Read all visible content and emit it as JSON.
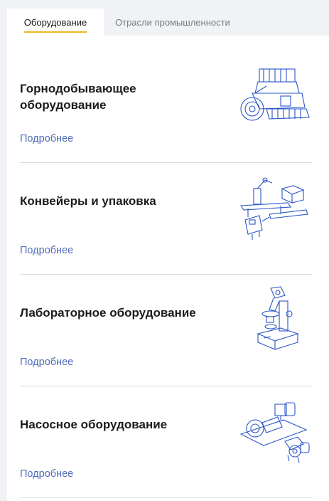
{
  "tabs": [
    {
      "label": "Оборудование",
      "active": true
    },
    {
      "label": "Отрасли промышленности",
      "active": false
    }
  ],
  "cards": [
    {
      "title": "Горнодобывающее оборудование",
      "link": "Подробнее",
      "illustration": "mining-machine-icon"
    },
    {
      "title": "Конвейеры и упаковка",
      "link": "Подробнее",
      "illustration": "conveyor-robot-arm-icon"
    },
    {
      "title": "Лабораторное оборудование",
      "link": "Подробнее",
      "illustration": "microscope-icon"
    },
    {
      "title": "Насосное оборудование",
      "link": "Подробнее",
      "illustration": "pump-unit-icon"
    }
  ],
  "colors": {
    "accent": "#f2b81d",
    "link": "#4f6db8",
    "illustration": "#2b55c8",
    "divider": "#d9dbe0"
  }
}
